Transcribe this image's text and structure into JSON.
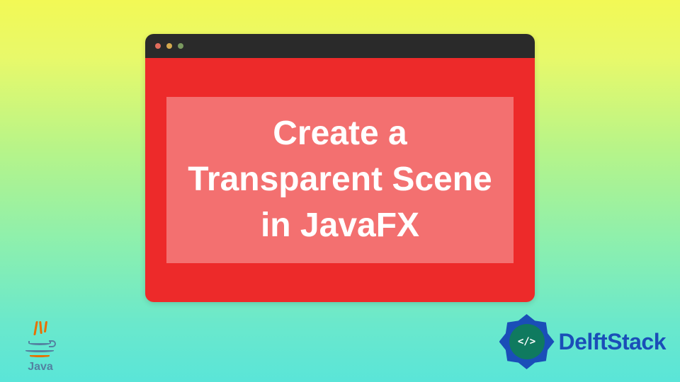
{
  "main": {
    "title": "Create a Transparent Scene in JavaFX"
  },
  "java_logo": {
    "label": "Java"
  },
  "delftstack": {
    "code_symbol": "</>",
    "brand": "DelftStack"
  }
}
